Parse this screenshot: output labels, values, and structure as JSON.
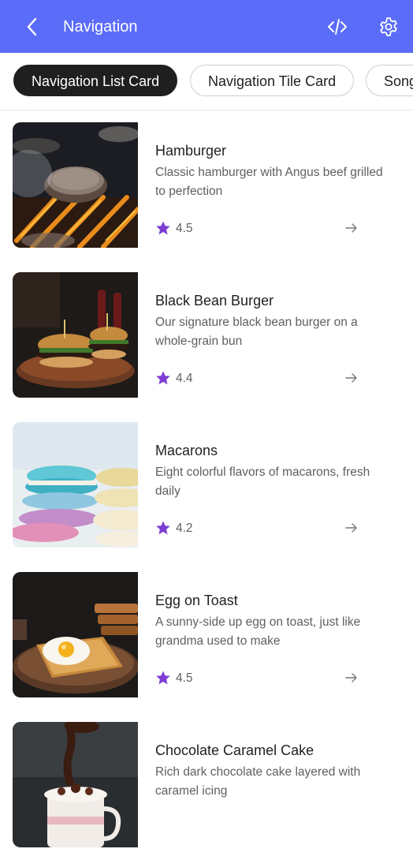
{
  "appbar": {
    "title": "Navigation",
    "background": "#5b6cf9",
    "icons": {
      "back": "back-arrow-icon",
      "code": "code-icon",
      "settings": "gear-icon"
    }
  },
  "tabs": [
    {
      "label": "Navigation List Card",
      "selected": true
    },
    {
      "label": "Navigation Tile Card",
      "selected": false
    },
    {
      "label": "Song",
      "selected": false
    }
  ],
  "items": [
    {
      "name": "Hamburger",
      "description": "Classic hamburger with Angus beef grilled to perfection",
      "rating": "4.5"
    },
    {
      "name": "Black Bean Burger",
      "description": "Our signature black bean burger on a whole-grain bun",
      "rating": "4.4"
    },
    {
      "name": "Macarons",
      "description": "Eight colorful flavors of macarons, fresh daily",
      "rating": "4.2"
    },
    {
      "name": "Egg on Toast",
      "description": "A sunny-side up egg on toast, just like grandma used to make",
      "rating": "4.5"
    },
    {
      "name": "Chocolate Caramel Cake",
      "description": "Rich dark chocolate cake layered with caramel icing",
      "rating": ""
    }
  ],
  "colors": {
    "accent": "#5b6cf9",
    "star": "#7e3ed3",
    "chip_selected": "#1f1f1f"
  }
}
